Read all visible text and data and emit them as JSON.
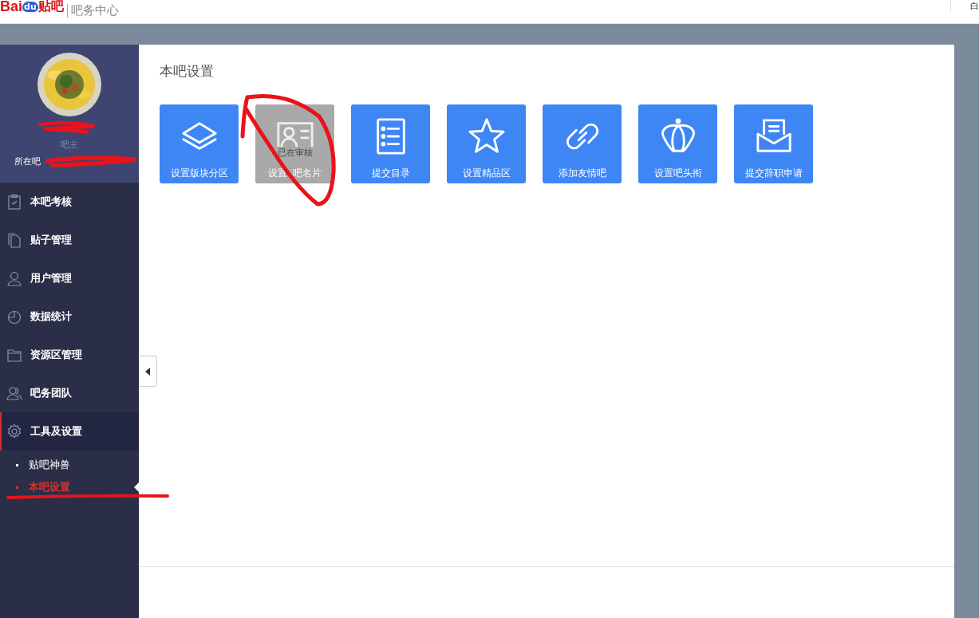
{
  "header": {
    "logo": {
      "part_1": "Bai",
      "part_2": "du",
      "part_3": "贴吧"
    },
    "title": "吧务中心",
    "right_text": "白"
  },
  "profile": {
    "role": "吧主",
    "bar_label": "所在吧"
  },
  "menu": [
    {
      "label": "本吧考核",
      "kind": "clipboard",
      "selected": false
    },
    {
      "label": "贴子管理",
      "kind": "document",
      "selected": false
    },
    {
      "label": "用户管理",
      "kind": "user",
      "selected": false
    },
    {
      "label": "数据统计",
      "kind": "pie",
      "selected": false
    },
    {
      "label": "资源区管理",
      "kind": "folder",
      "selected": false
    },
    {
      "label": "吧务团队",
      "kind": "team",
      "selected": false
    },
    {
      "label": "工具及设置",
      "kind": "gear",
      "selected": true,
      "children": [
        {
          "label": "贴吧神兽",
          "selected": false
        },
        {
          "label": "本吧设置",
          "selected": true
        }
      ]
    }
  ],
  "page": {
    "title": "本吧设置",
    "tiles": [
      {
        "label": "设置版块分区",
        "kind": "layers",
        "disabled": false
      },
      {
        "label": "设置  吧名片",
        "kind": "card",
        "disabled": true,
        "badge": "已在审核"
      },
      {
        "label": "提交目录",
        "kind": "list",
        "disabled": false
      },
      {
        "label": "设置精品区",
        "kind": "star",
        "disabled": false
      },
      {
        "label": "添加友情吧",
        "kind": "link",
        "disabled": false
      },
      {
        "label": "设置吧头衔",
        "kind": "crown",
        "disabled": false
      },
      {
        "label": "提交辞职申请",
        "kind": "mail",
        "disabled": false
      }
    ]
  }
}
